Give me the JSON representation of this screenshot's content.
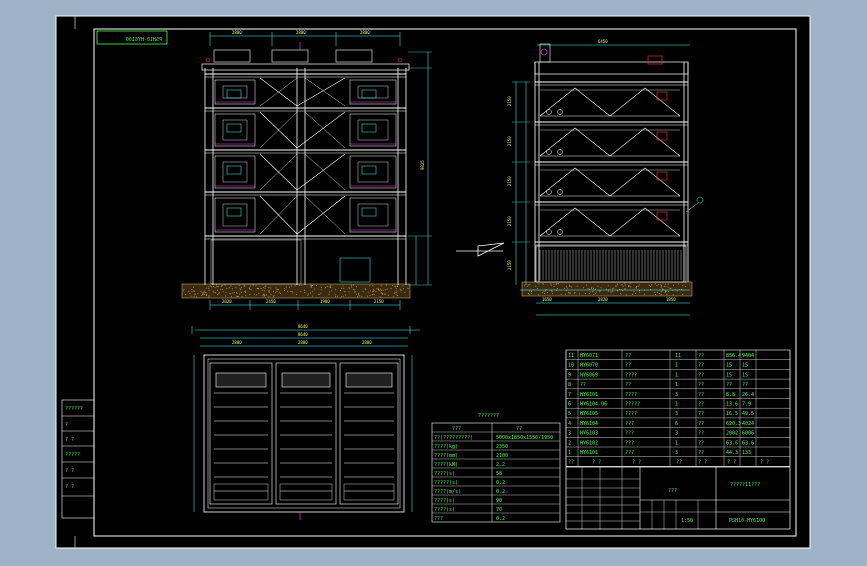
{
  "colors": {
    "outer_bg": "#9fb3c8",
    "paper": "#000000",
    "frame": "#ffffff",
    "structure": "#ffffff",
    "dimension": "#40ffff",
    "text": "#40ff40",
    "annotation": "#ffff40",
    "magenta": "#ff40ff",
    "red": "#ff3030",
    "ground": "#c8a060"
  },
  "drawing": {
    "code_mirrored": "PSH10-HY6100",
    "title_cell": "???",
    "company_cell": "?????11???",
    "drawing_no": "PSH10-HY6100",
    "scale": "1:50"
  },
  "left_block": {
    "rows": [
      "??????",
      "?",
      "?  ?",
      "?????",
      "?  ?",
      "?  ?"
    ]
  },
  "specs": {
    "title": "???????",
    "header": [
      "???",
      "??"
    ],
    "rows": [
      [
        "??(?????????)",
        "5000x1850x1550/1950"
      ],
      [
        "????(kg)",
        "2350"
      ],
      [
        "????(mm)",
        "2100"
      ],
      [
        "????(kW)",
        "2.2"
      ],
      [
        "????(s)",
        "58"
      ],
      [
        "?????(s)",
        "0.2"
      ],
      [
        "????(m/s)",
        "0.2"
      ],
      [
        "????(s)",
        "90"
      ],
      [
        "????(s)",
        "70"
      ],
      [
        "???",
        "0.2"
      ]
    ]
  },
  "bom": {
    "rows": [
      [
        "11",
        "HY6071",
        "??",
        "11",
        "??",
        "856.4",
        "9404"
      ],
      [
        "10",
        "HY6070",
        "??",
        "1",
        "??",
        "15",
        "15"
      ],
      [
        "9",
        "HY6069",
        "????",
        "1",
        "??",
        "15",
        "15"
      ],
      [
        "8",
        "??",
        "??",
        "1",
        "??",
        "??",
        "??"
      ],
      [
        "7",
        "HY6101",
        "????",
        "3",
        "??",
        "8.8",
        "26.4"
      ],
      [
        "6",
        "HY6104-06",
        "?????",
        "1",
        "??",
        "13.6",
        "7.9"
      ],
      [
        "5",
        "HY6105",
        "????",
        "3",
        "??",
        "16.5",
        "49.5"
      ],
      [
        "4",
        "HY6104",
        "???",
        "6",
        "??",
        "620.3",
        "4024"
      ],
      [
        "3",
        "HY6103",
        "???",
        "3",
        "??",
        "2002",
        "6006"
      ],
      [
        "2",
        "HY6102",
        "???",
        "1",
        "??",
        "63.6",
        "63.6"
      ],
      [
        "1",
        "HY6101",
        "???",
        "3",
        "??",
        "44.3",
        "133"
      ]
    ],
    "header": [
      "??",
      "?  ?",
      "? ?",
      "??",
      "?  ?",
      "? ?",
      "? ?"
    ]
  },
  "dims": {
    "top_widths": [
      "2880",
      "2880",
      "2880"
    ],
    "total_width": "8640",
    "bottom_widths": [
      "2020",
      "2450",
      "1980",
      "2150"
    ],
    "height_total": "9825",
    "side_depth": "6450",
    "side_offset": "1650",
    "level_heights": [
      "2150",
      "2150",
      "2150",
      "2150",
      "2150"
    ],
    "ground_h": "2150",
    "base_dims": [
      "1650",
      "2820",
      "1850"
    ],
    "plan_widths": [
      "2880",
      "2880",
      "2880"
    ],
    "plan_total": "8640"
  }
}
